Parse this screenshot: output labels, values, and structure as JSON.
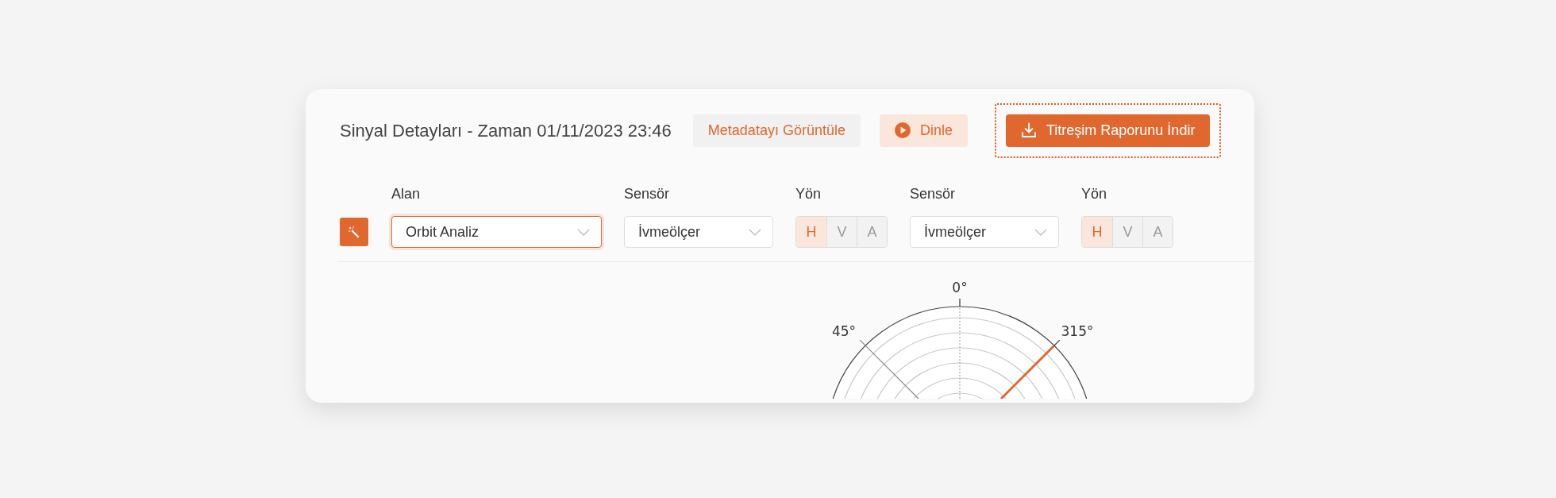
{
  "header": {
    "title": "Sinyal Detayları - Zaman 01/11/2023 23:46",
    "buttons": [
      {
        "kind": "secondary",
        "label": "Metadatayı Görüntüle",
        "focused": false
      },
      {
        "kind": "listen",
        "label": "Dinle",
        "focused": false
      },
      {
        "kind": "download",
        "label": "Titreşim Raporunu İndir",
        "focused": true
      }
    ]
  },
  "filters": [
    {
      "kind": "select",
      "label": "Alan",
      "value": "Orbit Analiz",
      "focused": true
    },
    {
      "kind": "select",
      "label": "Sensör",
      "value": "İvmeölçer",
      "focused": false
    },
    {
      "kind": "toggle",
      "label": "Yön",
      "options": [
        {
          "label": "H",
          "selected": true
        },
        {
          "label": "V",
          "selected": false
        },
        {
          "label": "A",
          "selected": false
        }
      ]
    },
    {
      "kind": "select",
      "label": "Sensör",
      "value": "İvmeölçer",
      "focused": false
    },
    {
      "kind": "toggle",
      "label": "Yön",
      "options": [
        {
          "label": "H",
          "selected": true
        },
        {
          "label": "V",
          "selected": false
        },
        {
          "label": "A",
          "selected": false
        }
      ]
    }
  ],
  "polar_plot": {
    "angle_labels": [
      "0°",
      "45°",
      "315°"
    ]
  }
}
